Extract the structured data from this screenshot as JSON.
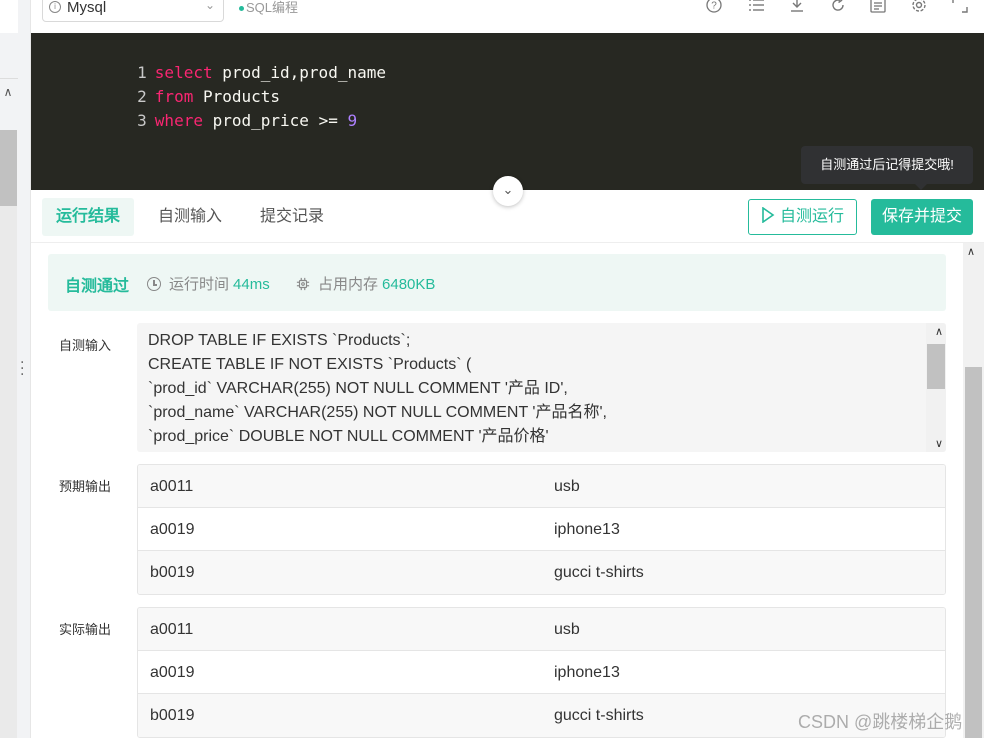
{
  "toolbar": {
    "language": "Mysql",
    "mode_tag": "SQL编程",
    "icons": [
      "help-icon",
      "list-icon",
      "download-icon",
      "refresh-icon",
      "template-icon",
      "settings-icon",
      "fullscreen-icon"
    ]
  },
  "editor": {
    "lines": [
      {
        "num": "1",
        "kw": "select",
        "rest": " prod_id,prod_name",
        "numeral": ""
      },
      {
        "num": "2",
        "kw": "from",
        "rest": " Products",
        "numeral": ""
      },
      {
        "num": "3",
        "kw": "where",
        "rest": " prod_price >= ",
        "numeral": "9"
      }
    ],
    "tooltip": "自测通过后记得提交哦!"
  },
  "tabs": {
    "items": [
      "运行结果",
      "自测输入",
      "提交记录"
    ],
    "active": 0,
    "run_button": "自测运行",
    "submit_button": "保存并提交"
  },
  "result": {
    "status": "自测通过",
    "runtime_label": "运行时间",
    "runtime_value": "44ms",
    "memory_label": "占用内存",
    "memory_value": "6480KB",
    "input_label": "自测输入",
    "input_text": "DROP TABLE IF EXISTS `Products`;\nCREATE TABLE IF NOT EXISTS `Products` (\n`prod_id` VARCHAR(255) NOT NULL COMMENT '产品 ID',\n`prod_name` VARCHAR(255) NOT NULL COMMENT '产品名称',\n`prod_price` DOUBLE NOT NULL COMMENT '产品价格'",
    "expected_label": "预期输出",
    "expected_rows": [
      [
        "a0011",
        "usb"
      ],
      [
        "a0019",
        "iphone13"
      ],
      [
        "b0019",
        "gucci t-shirts"
      ]
    ],
    "actual_label": "实际输出",
    "actual_rows": [
      [
        "a0011",
        "usb"
      ],
      [
        "a0019",
        "iphone13"
      ],
      [
        "b0019",
        "gucci t-shirts"
      ]
    ]
  },
  "watermark": "CSDN @跳楼梯企鹅",
  "colors": {
    "accent": "#25bb9b",
    "editor_bg": "#272822",
    "keyword": "#f92672",
    "number": "#ae81ff"
  }
}
